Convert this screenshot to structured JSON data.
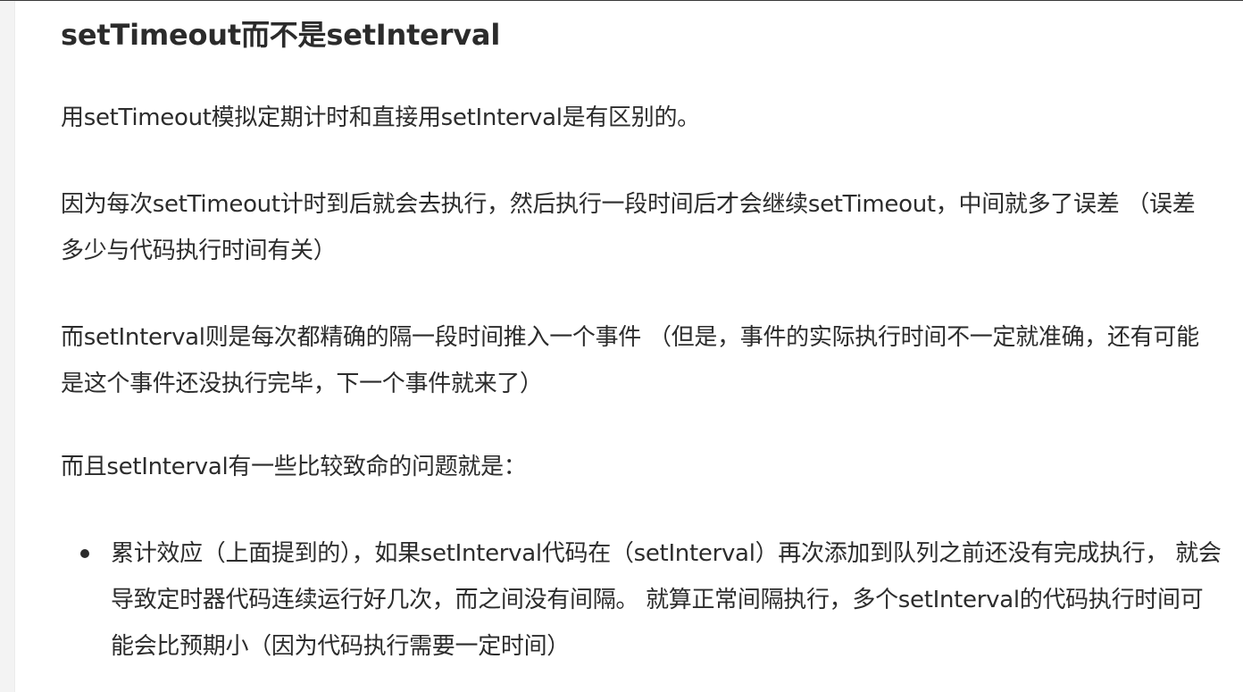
{
  "heading": "setTimeout而不是setInterval",
  "paragraphs": [
    "用setTimeout模拟定期计时和直接用setInterval是有区别的。",
    "因为每次setTimeout计时到后就会去执行，然后执行一段时间后才会继续setTimeout，中间就多了误差 （误差多少与代码执行时间有关）",
    "而setInterval则是每次都精确的隔一段时间推入一个事件 （但是，事件的实际执行时间不一定就准确，还有可能是这个事件还没执行完毕，下一个事件就来了）",
    "而且setInterval有一些比较致命的问题就是："
  ],
  "list": [
    "累计效应（上面提到的），如果setInterval代码在（setInterval）再次添加到队列之前还没有完成执行， 就会导致定时器代码连续运行好几次，而之间没有间隔。 就算正常间隔执行，多个setInterval的代码执行时间可能会比预期小（因为代码执行需要一定时间）"
  ]
}
